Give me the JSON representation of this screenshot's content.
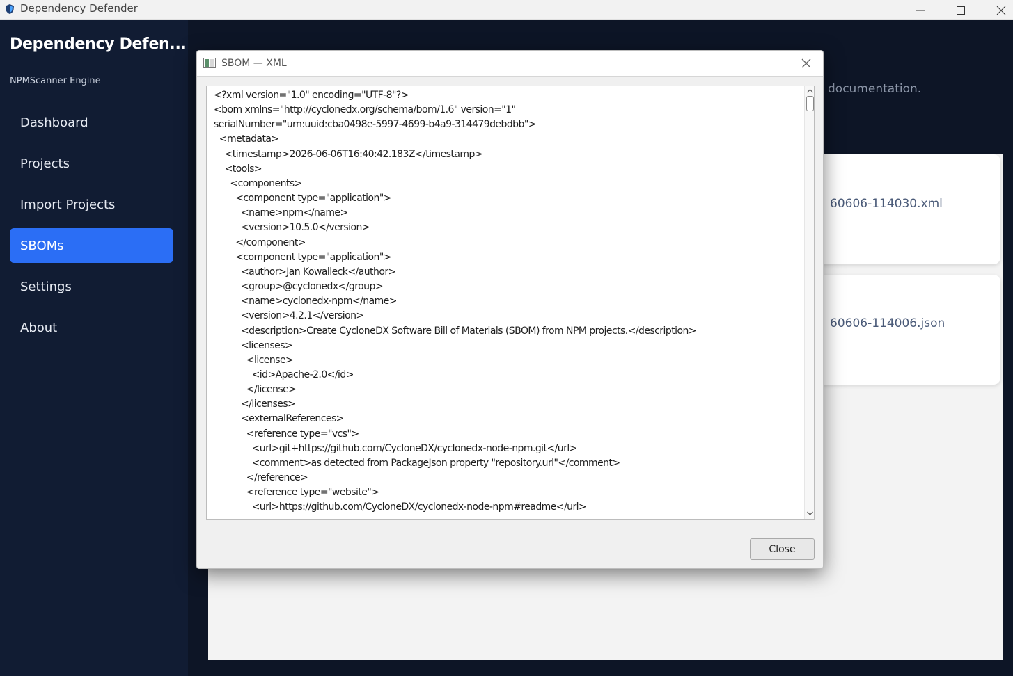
{
  "window": {
    "title": "Dependency Defender",
    "app_icon": "shield-icon"
  },
  "sidebar": {
    "brand": "Dependency Defen...",
    "subtitle": "NPMScanner Engine",
    "items": [
      {
        "label": "Dashboard",
        "active": false
      },
      {
        "label": "Projects",
        "active": false
      },
      {
        "label": "Import Projects",
        "active": false
      },
      {
        "label": "SBOMs",
        "active": true
      },
      {
        "label": "Settings",
        "active": false
      },
      {
        "label": "About",
        "active": false
      }
    ]
  },
  "main": {
    "doc_text": "documentation.",
    "cards": [
      {
        "filename": "60606-114030.xml"
      },
      {
        "filename": "60606-114006.json"
      }
    ]
  },
  "dialog": {
    "title": "SBOM — XML",
    "close_label": "Close",
    "lines": [
      "<?xml version=\"1.0\" encoding=\"UTF-8\"?>",
      "<bom xmlns=\"http://cyclonedx.org/schema/bom/1.6\" version=\"1\"",
      "serialNumber=\"urn:uuid:cba0498e-5997-4699-b4a9-314479debdbb\">",
      "  <metadata>",
      "    <timestamp>2026-06-06T16:40:42.183Z</timestamp>",
      "    <tools>",
      "      <components>",
      "        <component type=\"application\">",
      "          <name>npm</name>",
      "          <version>10.5.0</version>",
      "        </component>",
      "        <component type=\"application\">",
      "          <author>Jan Kowalleck</author>",
      "          <group>@cyclonedx</group>",
      "          <name>cyclonedx-npm</name>",
      "          <version>4.2.1</version>",
      "          <description>Create CycloneDX Software Bill of Materials (SBOM) from NPM projects.</description>",
      "          <licenses>",
      "            <license>",
      "              <id>Apache-2.0</id>",
      "            </license>",
      "          </licenses>",
      "          <externalReferences>",
      "            <reference type=\"vcs\">",
      "              <url>git+https://github.com/CycloneDX/cyclonedx-node-npm.git</url>",
      "              <comment>as detected from PackageJson property \"repository.url\"</comment>",
      "            </reference>",
      "            <reference type=\"website\">",
      "              <url>https://github.com/CycloneDX/cyclonedx-node-npm#readme</url>"
    ]
  }
}
